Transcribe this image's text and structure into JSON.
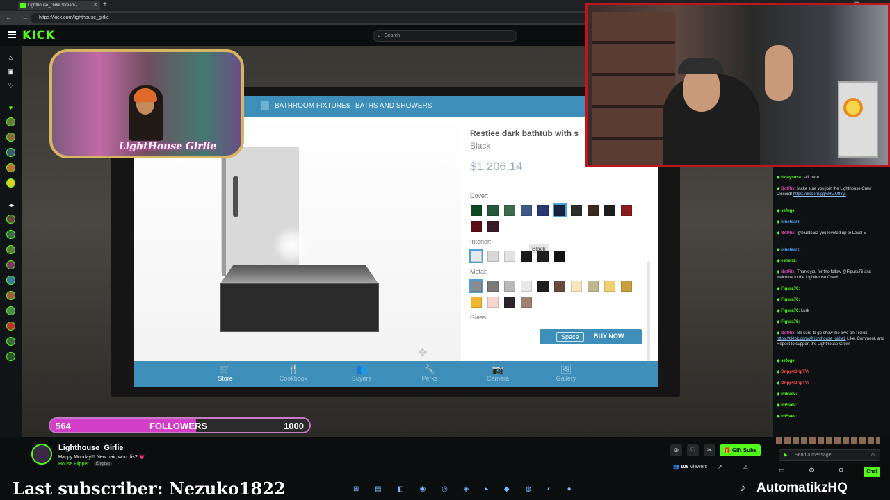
{
  "browser": {
    "tab_title": "Lighthouse_Girlie Stream - …",
    "url": "https://kick.com/lighthouse_girlie"
  },
  "kick": {
    "logo": "KICK",
    "search_placeholder": "Search"
  },
  "game": {
    "breadcrumb": [
      "BATHROOM FIXTURES",
      "BATHS AND SHOWERS"
    ],
    "product": {
      "name": "Restiee dark bathtub with s",
      "variant": "Black",
      "price": "$1,206.14"
    },
    "sections": {
      "cover": "Cover:",
      "interior": "Interior:",
      "metal": "Metal:",
      "glass": "Glass:"
    },
    "cover_colors": [
      "#0d4a22",
      "#24583a",
      "#3b6b4b",
      "#3e5a8a",
      "#2a3a72",
      "#17233f",
      "#2d2d2d",
      "#3c2a20",
      "#1e1e1e",
      "#8c1a1f",
      "#5a0f14",
      "#3a1a2a"
    ],
    "interior_colors": [
      "#e6e8ea",
      "#d8d8d8",
      "#e2e2e2",
      "#1a1a1a",
      "#202020",
      "#121212"
    ],
    "metal_colors": [
      "#8a8d90",
      "#7a7a7a",
      "#b8b8b8",
      "#e8e8e8",
      "#1e1e1e",
      "#6a4a3c",
      "#fbe5bf",
      "#c2b890",
      "#f0d070",
      "#c8a040",
      "#f1b630",
      "#f7d6d0",
      "#2a2426",
      "#a08070"
    ],
    "tooltip": "Black",
    "buy": {
      "key": "Space",
      "label": "BUY NOW"
    },
    "nav": [
      {
        "label": "Store",
        "icon": "store-icon"
      },
      {
        "label": "Cookbook",
        "icon": "cookbook-icon"
      },
      {
        "label": "Buyers",
        "icon": "buyers-icon"
      },
      {
        "label": "Perks",
        "icon": "perks-icon"
      },
      {
        "label": "Camera",
        "icon": "camera-icon"
      },
      {
        "label": "Gallery",
        "icon": "gallery-icon"
      }
    ]
  },
  "overlay": {
    "cam1_logo": "LightHouse Girlie",
    "followers": {
      "count": "564",
      "label": "FOLLOWERS",
      "goal": "1000",
      "progress": 0.564
    },
    "last_subscriber": "Last subscriber: Nezuko1822",
    "brand": "AutomatikzHQ"
  },
  "channel": {
    "name": "Lighthouse_Girlie",
    "title": "Happy Monday!!! New hair, who dis? 💗",
    "category": "House Flipper",
    "language": "English",
    "viewers_count": "106",
    "viewers_label": "Viewers",
    "gift_label": "Gift Subs"
  },
  "chat": {
    "messages": [
      {
        "user": "itzjaysosa:",
        "color": "#53fc18",
        "text": " still here"
      },
      {
        "user": "BotRix:",
        "color": "#d04ab0",
        "text": " Make sure you join the Lighthouse Crew Discord! ",
        "link": "https://discord.gg/cHtZUffYyj"
      },
      {
        "user": "sefoge:",
        "color": "#53fc18",
        "text": ""
      },
      {
        "user": "bluetearz:",
        "color": "#5aa0ff",
        "text": ""
      },
      {
        "user": "BotRix:",
        "color": "#d04ab0",
        "text": " @bluetearz you leveled up to Level 5"
      },
      {
        "user": "bluetearz:",
        "color": "#5aa0ff",
        "text": ""
      },
      {
        "user": "eshens:",
        "color": "#53fc18",
        "text": ""
      },
      {
        "user": "BotRix:",
        "color": "#d04ab0",
        "text": " Thank you for the follow @Figura76 and welcome to the Lighthouse Crew!"
      },
      {
        "user": "Figura76:",
        "color": "#53fc18",
        "text": ""
      },
      {
        "user": "Figura76:",
        "color": "#53fc18",
        "text": ""
      },
      {
        "user": "Figura76:",
        "color": "#53fc18",
        "text": " Lurk"
      },
      {
        "user": "Figura76:",
        "color": "#53fc18",
        "text": ""
      },
      {
        "user": "BotRix:",
        "color": "#d04ab0",
        "text": " Be sure to go show me love on TikTok ",
        "link": "https://tiktok.com/@lighthouse_girlie1",
        "after": " Like, Comment, and Repost to support the Lighthouse Crew!"
      },
      {
        "user": "sefoge:",
        "color": "#53fc18",
        "text": ""
      },
      {
        "user": "DrippyDripTV:",
        "color": "#ff4d4d",
        "text": ""
      },
      {
        "user": "DrippyDripTV:",
        "color": "#ff4d4d",
        "text": ""
      },
      {
        "user": "imSvev:",
        "color": "#53fc18",
        "text": ""
      },
      {
        "user": "imSvev:",
        "color": "#53fc18",
        "text": ""
      },
      {
        "user": "imSvev:",
        "color": "#53fc18",
        "text": ""
      }
    ],
    "input_placeholder": "Send a message",
    "chat_button": "Chat"
  }
}
